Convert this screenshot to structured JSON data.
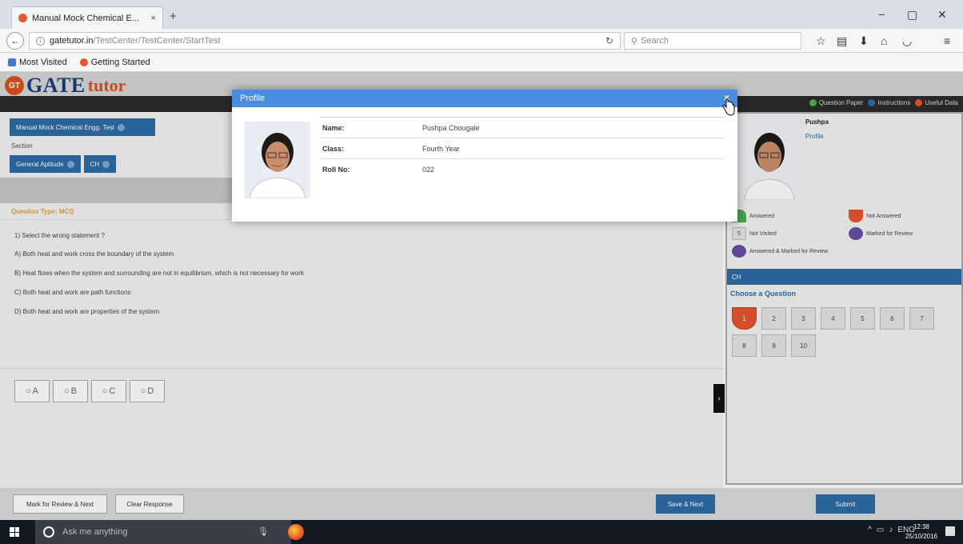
{
  "browser": {
    "tab_title": "Manual Mock Chemical E...",
    "tab_close": "×",
    "new_tab": "+",
    "url_host": "gatetutor.in",
    "url_path": "/TestCenter/TestCenter/StartTest",
    "search_placeholder": "Search",
    "bookmarks": [
      "Most Visited",
      "Getting Started"
    ],
    "win_minimize": "−",
    "win_restore": "▢",
    "win_close": "✕"
  },
  "site": {
    "logo_badge": "GT",
    "logo_gate": "GATE",
    "logo_tutor": "tutor",
    "top_links": [
      {
        "label": "Question Paper",
        "color": "#4caf50"
      },
      {
        "label": "Instructions",
        "color": "#2e6da4"
      },
      {
        "label": "Useful Data",
        "color": "#e8552f"
      }
    ]
  },
  "test": {
    "name_button": "Manual Mock Chemical Engg. Test",
    "section_label": "Section",
    "sections": [
      "General Aptitude",
      "CH"
    ],
    "question_type": "Question Type: MCQ",
    "question": "1) Select the wrong statement ?",
    "options": [
      "A) Both heat and work cross the boundary of the system",
      "B) Heat flows when the system and surrounding are not in equilibrium, which is not necessary for work",
      "C) Both heat and work are path functions",
      "D) Both heat and work are properties of the system"
    ],
    "answer_choices": [
      "A",
      "B",
      "C",
      "D"
    ]
  },
  "bottom": {
    "mark_review": "Mark for Review & Next",
    "clear_response": "Clear Response",
    "save_next": "Save & Next",
    "submit": "Submit"
  },
  "panel": {
    "student_name": "Pushpa",
    "profile_link": "Profile",
    "legend": {
      "answered": "Answered",
      "not_answered": "Not Answered",
      "not_visited": "Not Visited",
      "not_visited_count": "5",
      "marked_review": "Marked for Review",
      "answered_marked": "Answered & Marked for Review"
    },
    "section_header": "CH",
    "choose_label": "Choose a Question",
    "questions": [
      "1",
      "2",
      "3",
      "4",
      "5",
      "6",
      "7",
      "8",
      "9",
      "10"
    ]
  },
  "modal": {
    "title": "Profile",
    "close": "×",
    "rows": [
      {
        "label": "Name:",
        "value": "Pushpa Chougale"
      },
      {
        "label": "Class:",
        "value": "Fourth Year"
      },
      {
        "label": "Roll No:",
        "value": "022"
      }
    ]
  },
  "taskbar": {
    "search_text": "Ask me anything",
    "lang": "ENG",
    "time": "12:38",
    "date": "25/10/2016"
  }
}
